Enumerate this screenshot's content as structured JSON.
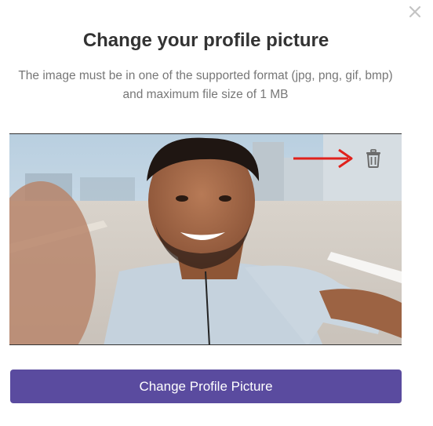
{
  "dialog": {
    "title": "Change your profile picture",
    "subtitle": "The image must be in one of the supported format (jpg, png, gif, bmp) and maximum file size of 1 MB",
    "close_icon": "close-icon",
    "primary_button_label": "Change Profile Picture"
  },
  "preview": {
    "delete_icon": "trash-icon",
    "annotation_icon": "red-arrow-icon"
  },
  "colors": {
    "primary": "#5a4b9f",
    "annotation": "#e0211c",
    "title_text": "#333333",
    "subtitle_text": "#777777"
  }
}
